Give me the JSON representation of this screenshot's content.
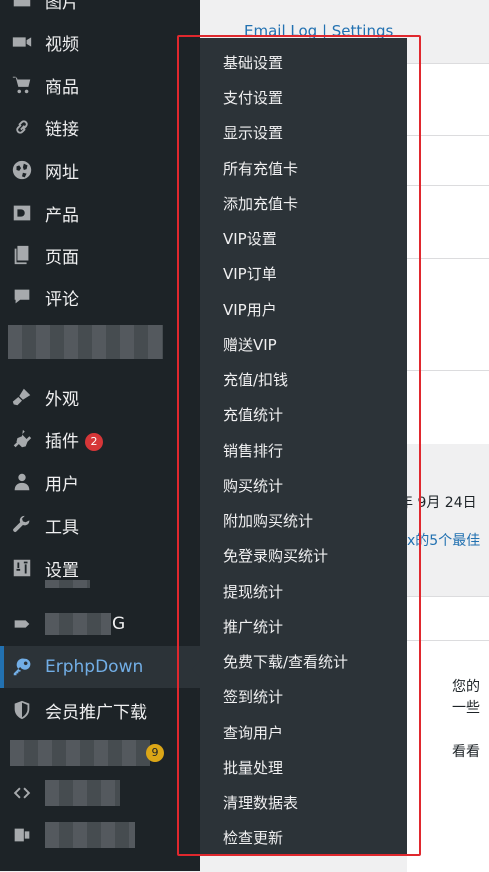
{
  "sidebar": {
    "items": [
      {
        "label": "图片",
        "icon": "image-icon"
      },
      {
        "label": "视频",
        "icon": "video-icon"
      },
      {
        "label": "商品",
        "icon": "cart-icon"
      },
      {
        "label": "链接",
        "icon": "link-icon"
      },
      {
        "label": "网址",
        "icon": "globe-icon"
      },
      {
        "label": "产品",
        "icon": "product-icon"
      },
      {
        "label": "页面",
        "icon": "pages-icon"
      },
      {
        "label": "评论",
        "icon": "comment-icon"
      },
      {
        "label": "外观",
        "icon": "brush-icon"
      },
      {
        "label": "插件",
        "icon": "plugin-icon",
        "badge": "2"
      },
      {
        "label": "用户",
        "icon": "user-icon"
      },
      {
        "label": "工具",
        "icon": "wrench-icon"
      },
      {
        "label": "设置",
        "icon": "settings-icon"
      },
      {
        "label": "G",
        "icon": "tag-icon"
      },
      {
        "label": "ErphpDown",
        "icon": "key-icon",
        "active": true
      },
      {
        "label": "会员推广下载",
        "icon": "shield-icon"
      }
    ],
    "hidden_badge": "9"
  },
  "flyout": {
    "items": [
      "基础设置",
      "支付设置",
      "显示设置",
      "所有充值卡",
      "添加充值卡",
      "VIP设置",
      "VIP订单",
      "VIP用户",
      "赠送VIP",
      "充值/扣钱",
      "充值统计",
      "销售排行",
      "购买统计",
      "附加购买统计",
      "免登录购买统计",
      "提现统计",
      "推广统计",
      "免费下载/查看统计",
      "签到统计",
      "查询用户",
      "批量处理",
      "清理数据表",
      "检查更新"
    ]
  },
  "content": {
    "top_link": "Email Log | Settings",
    "date_peek": "年 9月 24日",
    "link_peek": "x的5个最佳",
    "text_peek_1": "您的",
    "text_peek_2": "一些",
    "text_peek_3": "看看"
  },
  "colors": {
    "sidebar_bg": "#1d2327",
    "flyout_bg": "#2c3338",
    "active_text": "#72aee6",
    "highlight": "#e0282e",
    "badge_red": "#d63638"
  }
}
